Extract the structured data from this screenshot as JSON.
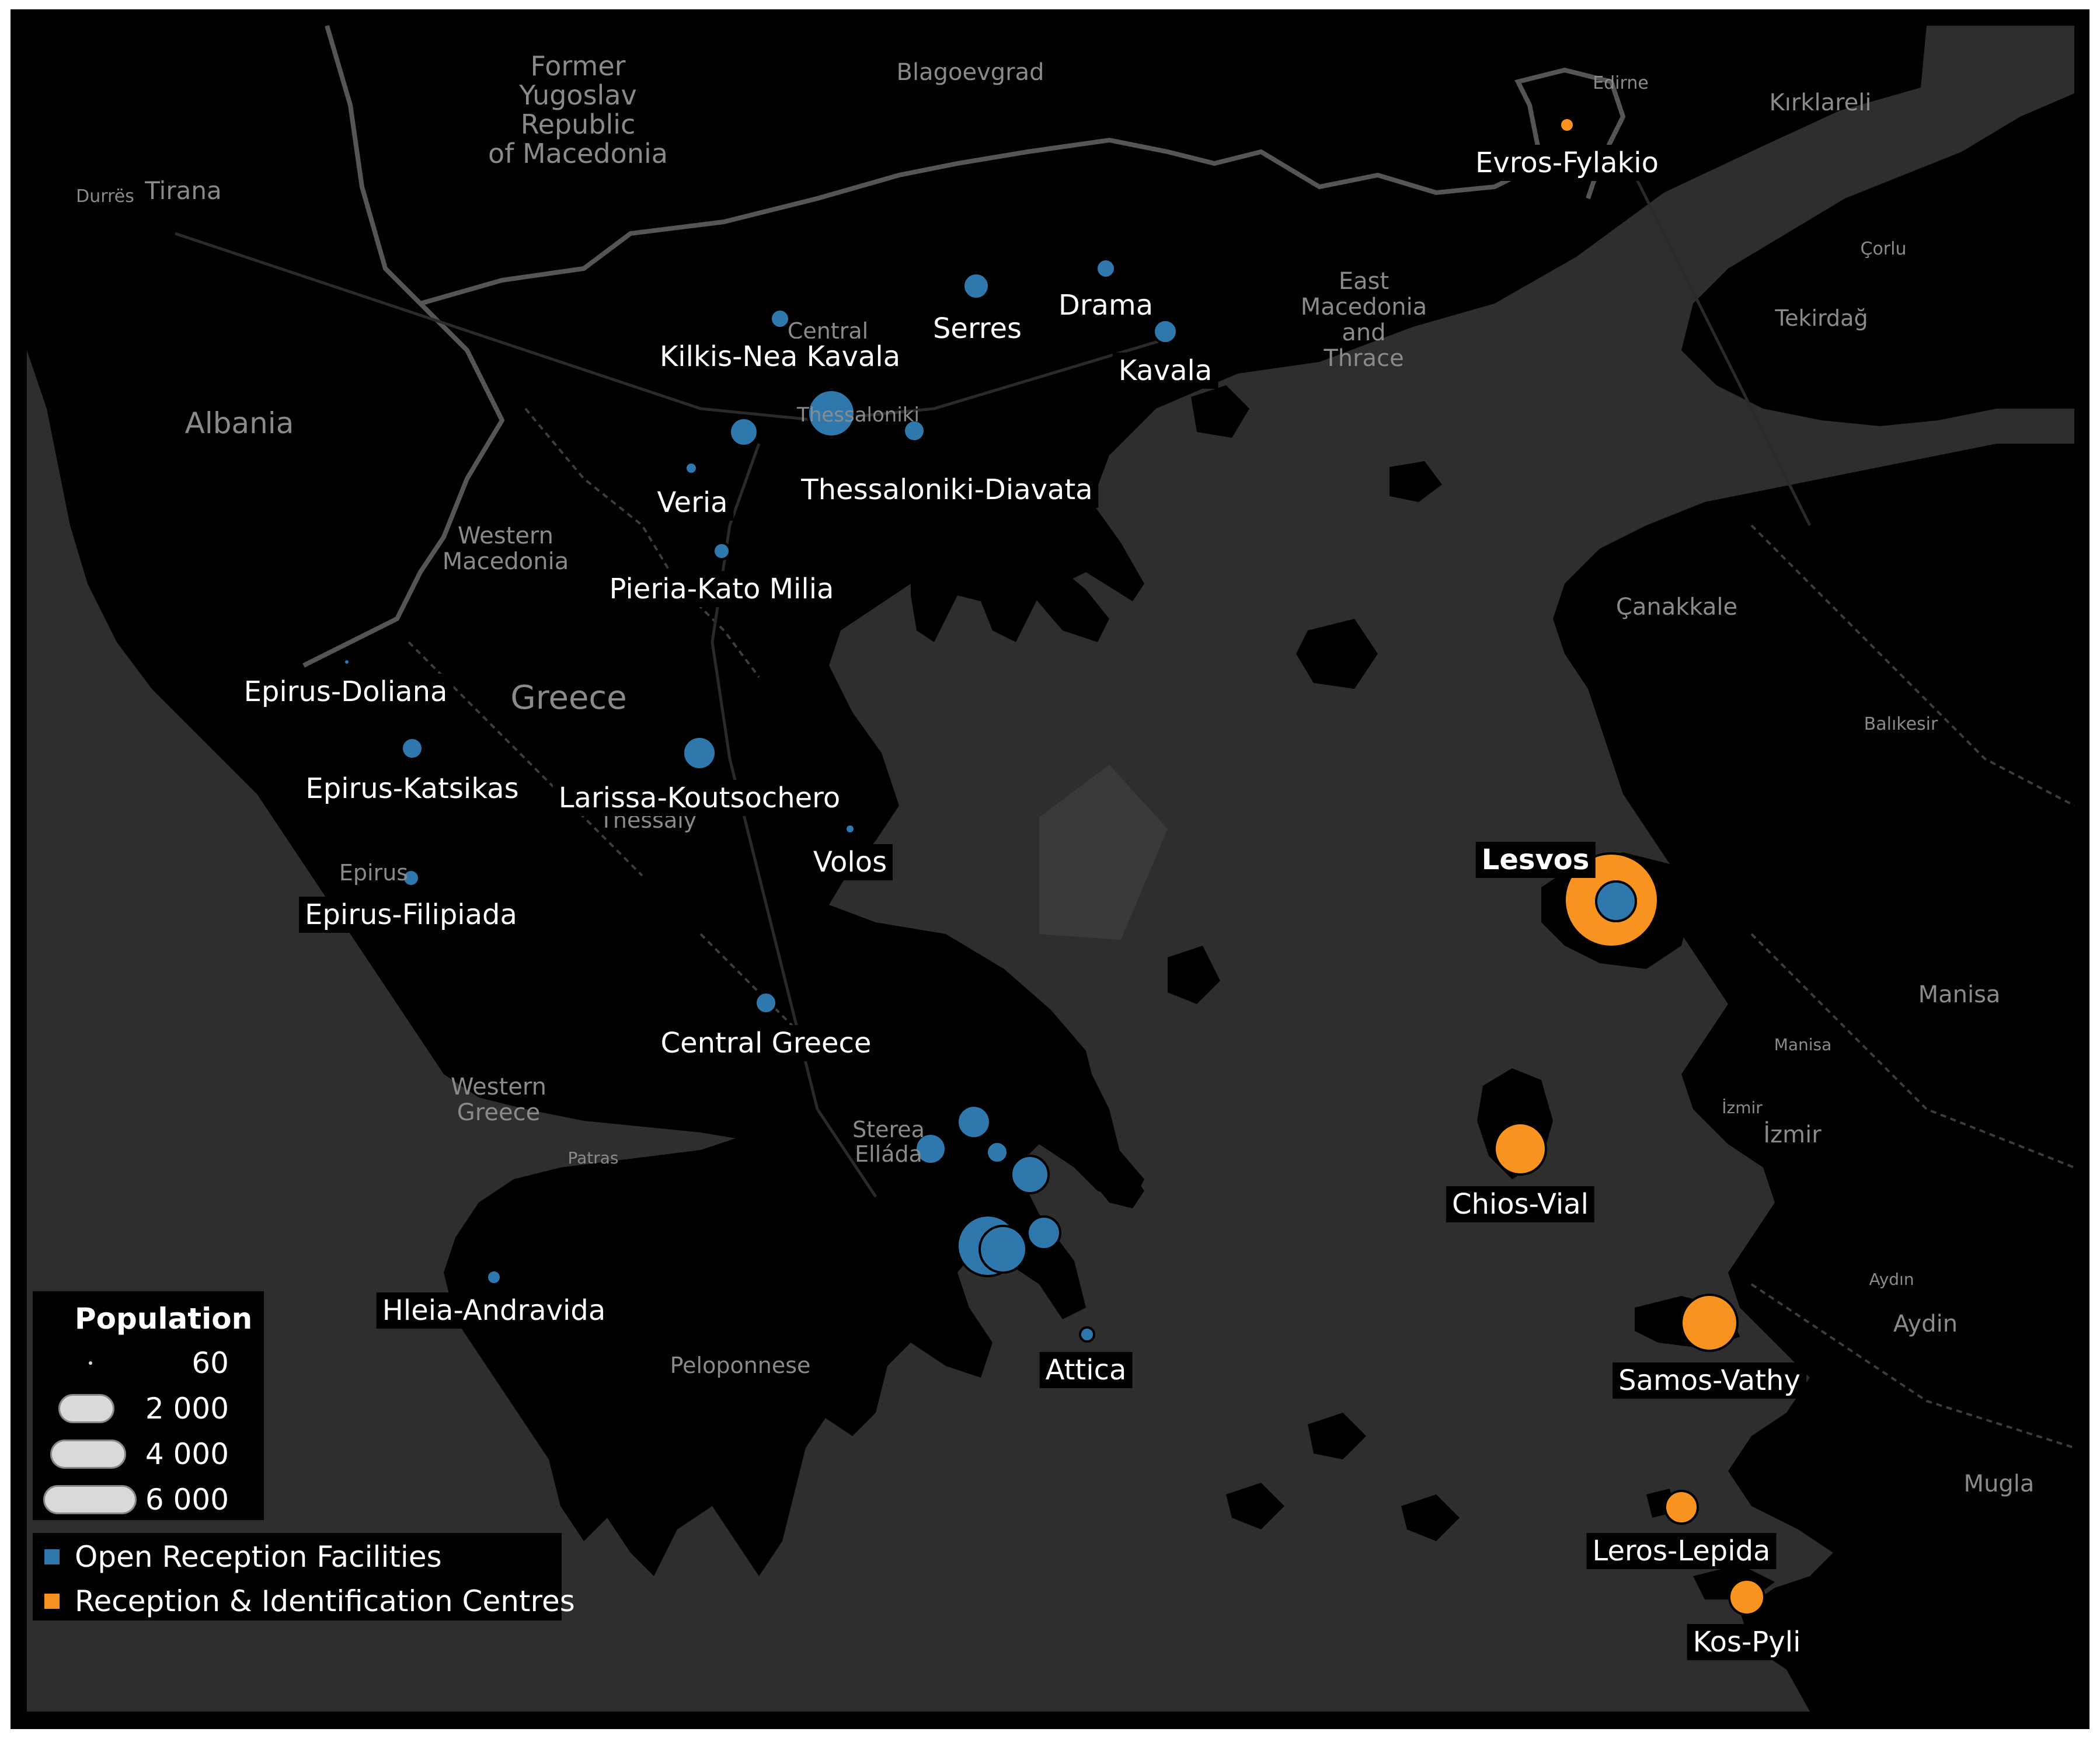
{
  "colors": {
    "open_reception": "#2f78ad",
    "reception_identification": "#f7931e",
    "land": "#000000",
    "sea": "#2e2e2e",
    "label_bg": "#000000",
    "label_text": "#ffffff",
    "basemap_text": "#8a8a8a"
  },
  "legend": {
    "size_title": "Population",
    "sizes": [
      "60",
      "2 000",
      "4 000",
      "6 000"
    ],
    "colors": [
      {
        "label": "Open Reception Facilities",
        "color": "#2f78ad"
      },
      {
        "label": "Reception & Identification Centres",
        "color": "#f7931e"
      }
    ]
  },
  "site_labels": [
    "Evros-Fylakio",
    "Drama",
    "Serres",
    "Kavala",
    "Kilkis-Nea Kavala",
    "Thessaloniki-Diavata",
    "Veria",
    "Pieria-Kato Milia",
    "Epirus-Doliana",
    "Epirus-Katsikas",
    "Larissa-Koutsochero",
    "Volos",
    "Epirus-Filipiada",
    "Central Greece",
    "Hleia-Andravida",
    "Attica",
    "Lesvos",
    "Chios-Vial",
    "Samos-Vathy",
    "Leros-Lepida",
    "Kos-Pyli"
  ],
  "place_labels": [
    "Former",
    "Yugoslav",
    "Republic",
    "of Macedonia",
    "Blagoevgrad",
    "Edirne",
    "Kırklareli",
    "Durrës",
    "Tirana",
    "Albania",
    "East",
    "Macedonia",
    "and",
    "Thrace",
    "Çorlu",
    "Tekirdağ",
    "Central",
    "Thessaloniki",
    "Western",
    "Macedonia",
    "Greece",
    "Çanakkale",
    "Balıkesir",
    "Thessaly",
    "Epirus",
    "Manisa",
    "Manisa",
    "Western",
    "Greece",
    "Patras",
    "Sterea",
    "Elláda",
    "İzmir",
    "İzmir",
    "Peloponnese",
    "Aydın",
    "Aydin",
    "Mugla"
  ]
}
